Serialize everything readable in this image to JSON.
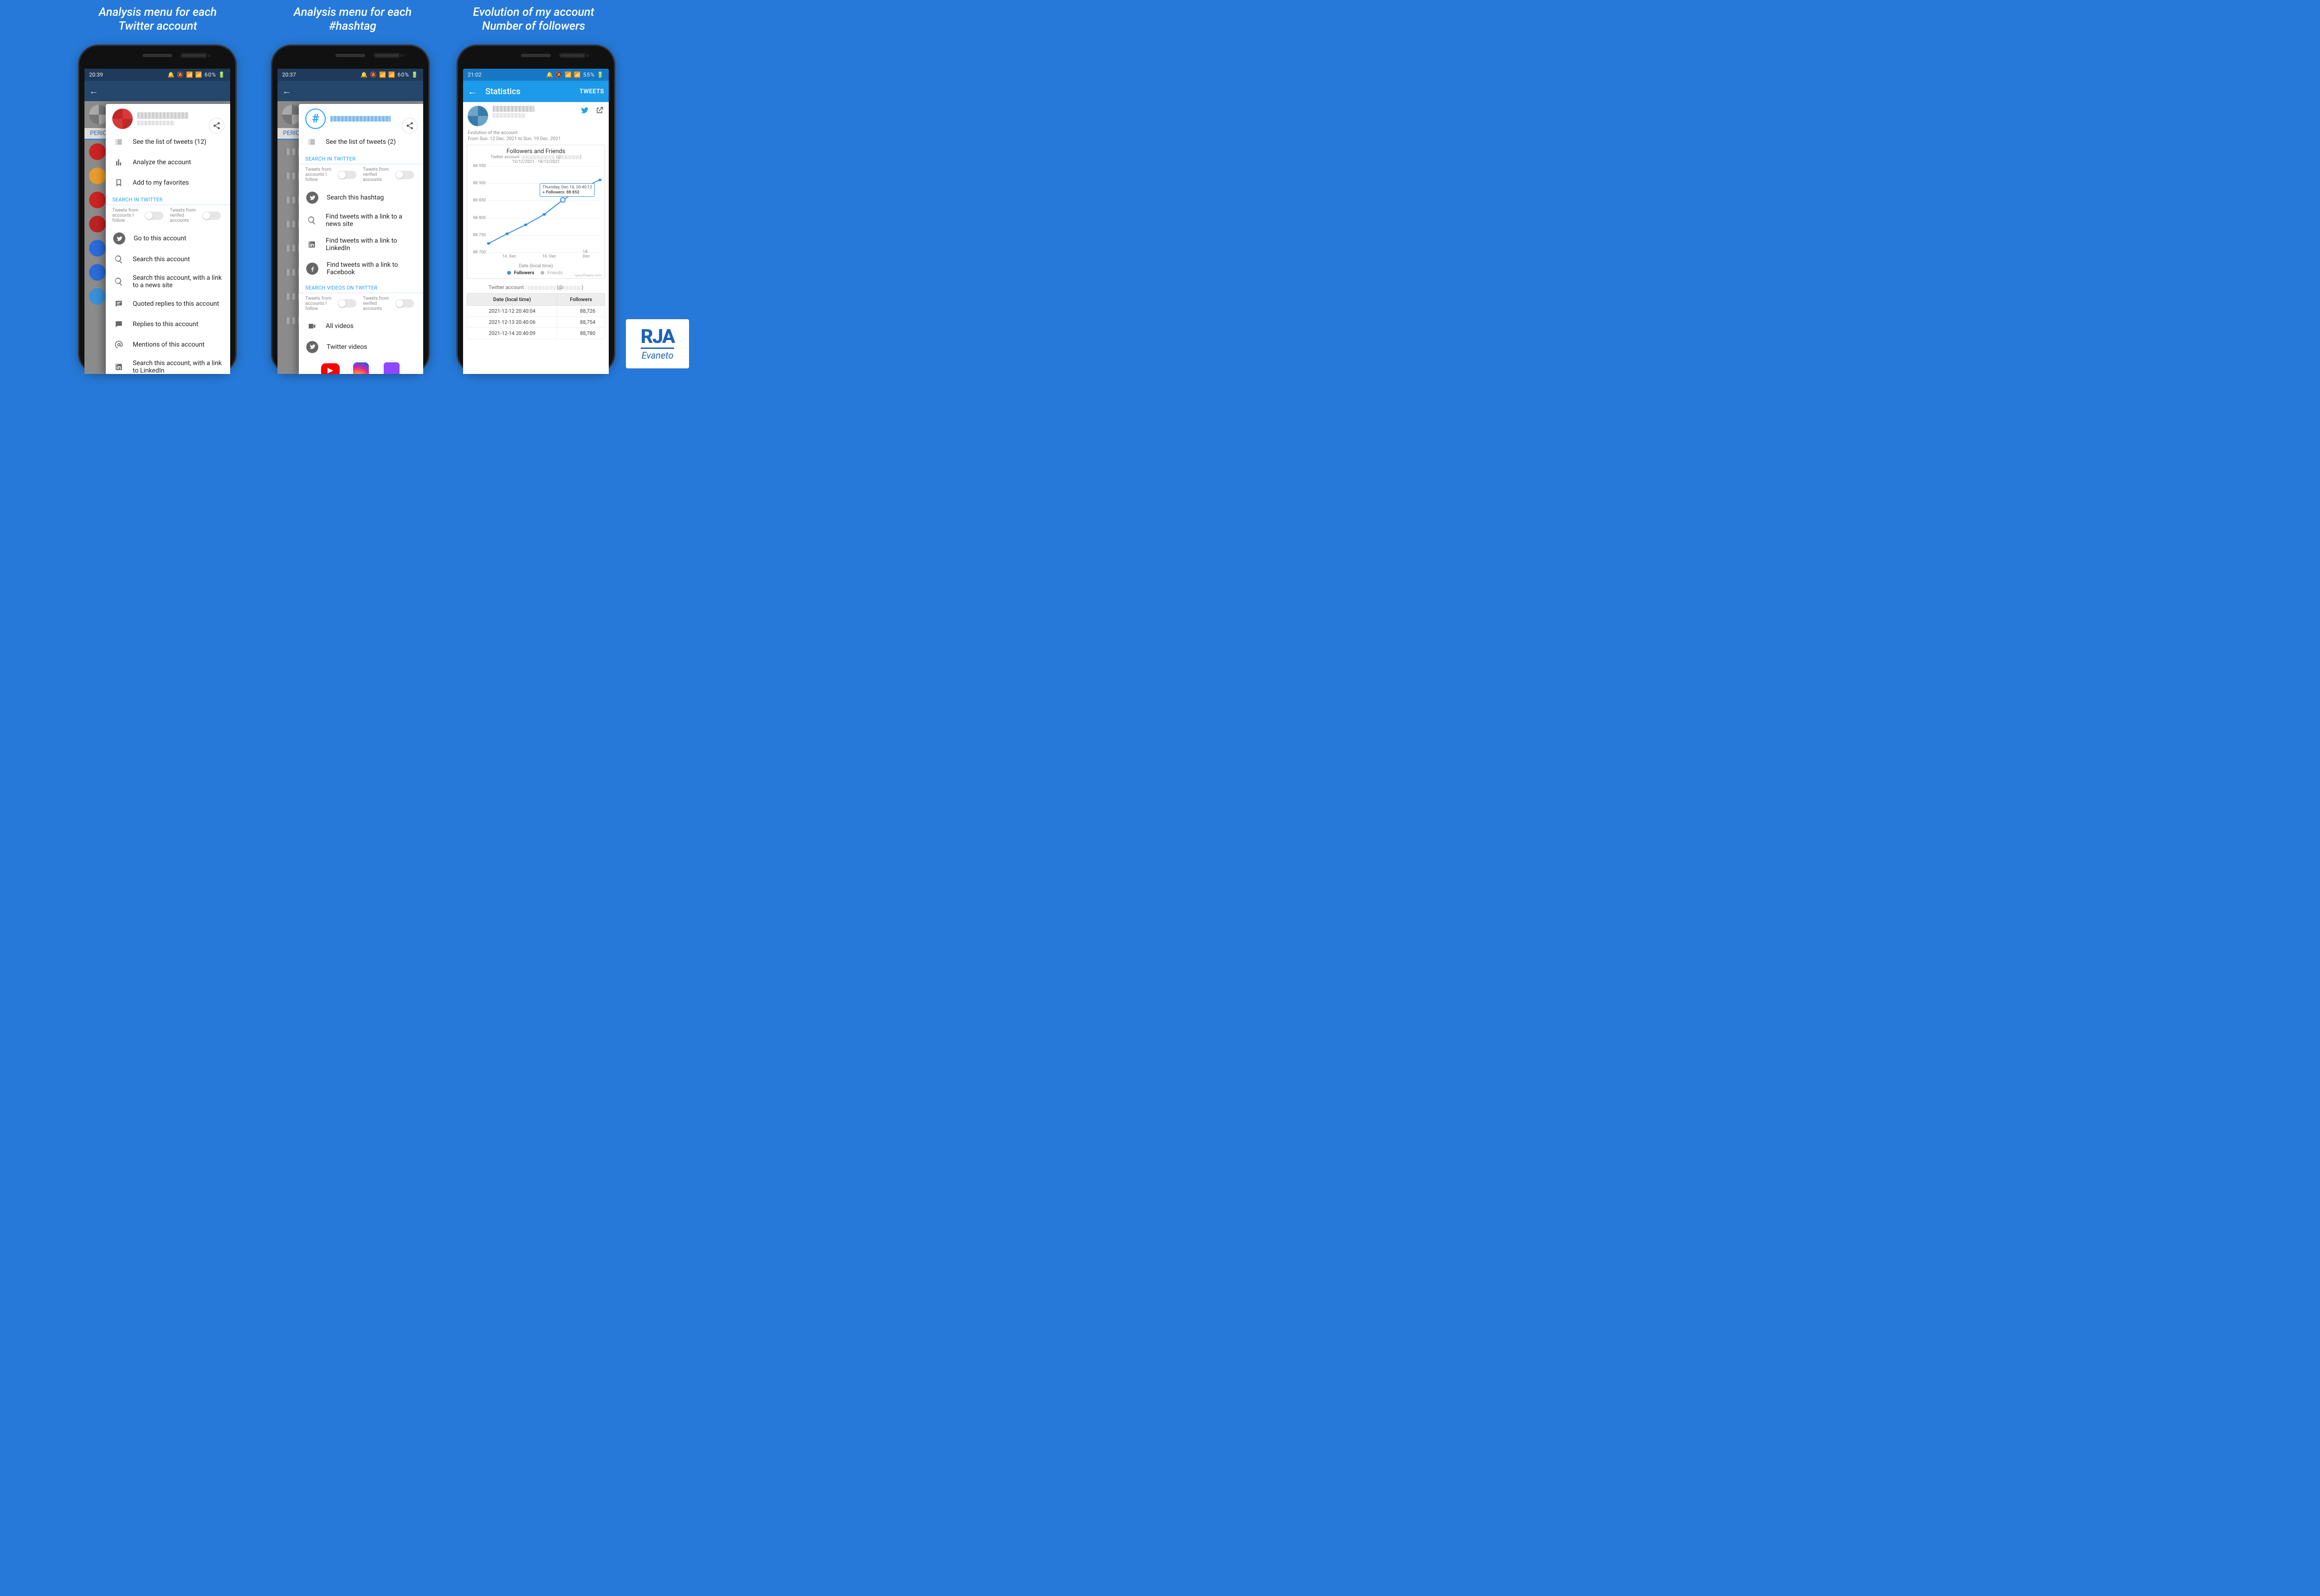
{
  "captions": {
    "c1a": "Analysis menu for each",
    "c1b": "Twitter account",
    "c2a": "Analysis menu for each",
    "c2b": "#hashtag",
    "c3a": "Evolution of my account",
    "c3b": "Number of followers"
  },
  "phone1": {
    "status_time": "20:39",
    "status_right": "🔔 🔕 📶 📶 60% 🔋",
    "perio": "PERIO",
    "menu": {
      "see_list": "See the list of tweets (12)",
      "analyze": "Analyze the account",
      "favorites": "Add to my favorites",
      "section_search": "SEARCH IN TWITTER",
      "tog_follow": "Tweets from accounts I follow",
      "tog_verified": "Tweets from verifed accounts",
      "goto": "Go to this account",
      "search_acct": "Search this account",
      "search_news": "Search this account, with a link to a news site",
      "quoted": "Quoted replies to this account",
      "replies": "Replies to this account",
      "mentions": "Mentions of this account",
      "linkedin": "Search this account, with a link to LinkedIn"
    }
  },
  "phone2": {
    "status_time": "20:37",
    "status_right": "🔔 🔕 📶 📶 60% 🔋",
    "perio": "PERIO",
    "menu": {
      "see_list": "See the list of tweets (2)",
      "section_search": "SEARCH IN TWITTER",
      "tog_follow": "Tweets from accounts I follow",
      "tog_verified": "Tweets from verifed accounts",
      "search_hashtag": "Search this hashtag",
      "find_news": "Find tweets with a link to a news site",
      "find_linkedin": "Find tweets with a link to LinkedIn",
      "find_facebook": "Find tweets with a link to Facebook",
      "section_videos": "SEARCH VIDEOS ON TWITTER",
      "all_videos": "All videos",
      "twitter_videos": "Twitter videos"
    }
  },
  "phone3": {
    "status_time": "21:02",
    "status_right": "🔔 🔕 📶 📶 55% 🔋",
    "title": "Statistics",
    "tweets_button": "TWEETS",
    "subnote1": "Evolution of the account",
    "subnote2": "From Sun. 12 Dec. 2021 to Sun. 19 Dec. 2021",
    "chart": {
      "title": "Followers and Friends",
      "sub1": "Twitter account :",
      "sub2": "12/12/2021 - 18/12/2021",
      "xlabel": "Date (local time)",
      "legend_followers": "Followers",
      "legend_friends": "Friends",
      "tooltip_time": "Thursday, Dec 16, 20:40:12",
      "tooltip_val": "Followers: 88 852",
      "watermark": "rjasoftware.com"
    },
    "table_caption": "Twitter account :",
    "table": {
      "h1": "Date (local time)",
      "h2": "Followers",
      "r1d": "2021-12-12 20:40:04",
      "r1v": "88,726",
      "r2d": "2021-12-13 20:40:06",
      "r2v": "88,754",
      "r3d": "2021-12-14 20:40:09",
      "r3v": "88,780"
    }
  },
  "logo": {
    "rja": "RJA",
    "ev": "Evaneto"
  },
  "chart_data": {
    "type": "line",
    "title": "Followers and Friends",
    "subtitle": "12/12/2021 - 18/12/2021",
    "xlabel": "Date (local time)",
    "ylabel": "",
    "ylim": [
      88700,
      88950
    ],
    "x_tick_labels": [
      "14. Dec",
      "16. Dec",
      "18. Dec"
    ],
    "y_tick_labels": [
      "88 700",
      "88 750",
      "88 800",
      "88 850",
      "88 900",
      "88 950"
    ],
    "categories": [
      "2021-12-12",
      "2021-12-13",
      "2021-12-14",
      "2021-12-15",
      "2021-12-16",
      "2021-12-17",
      "2021-12-18"
    ],
    "series": [
      {
        "name": "Followers",
        "color": "#338fe0",
        "values": [
          88726,
          88754,
          88780,
          88810,
          88852,
          88885,
          88910
        ]
      },
      {
        "name": "Friends",
        "color": "#aaaaaa",
        "values": null
      }
    ],
    "tooltip": {
      "index": 4,
      "label": "Thursday, Dec 16, 20:40:12",
      "value_label": "Followers: 88 852"
    },
    "legend_position": "bottom",
    "grid": true
  }
}
